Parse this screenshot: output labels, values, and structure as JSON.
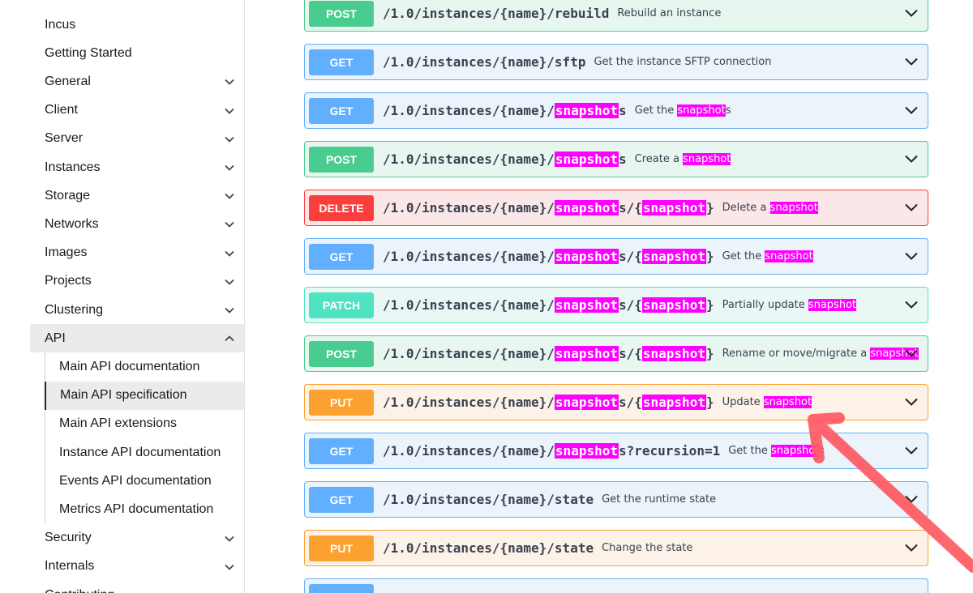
{
  "sidebar": {
    "items": [
      {
        "label": "Incus",
        "chevron": false
      },
      {
        "label": "Getting Started",
        "chevron": false
      },
      {
        "label": "General",
        "chevron": true
      },
      {
        "label": "Client",
        "chevron": true
      },
      {
        "label": "Server",
        "chevron": true
      },
      {
        "label": "Instances",
        "chevron": true
      },
      {
        "label": "Storage",
        "chevron": true
      },
      {
        "label": "Networks",
        "chevron": true
      },
      {
        "label": "Images",
        "chevron": true
      },
      {
        "label": "Projects",
        "chevron": true
      },
      {
        "label": "Clustering",
        "chevron": true
      },
      {
        "label": "API",
        "chevron": true,
        "expanded": true
      }
    ],
    "api_children": [
      "Main API documentation",
      "Main API specification",
      "Main API extensions",
      "Instance API documentation",
      "Events API documentation",
      "Metrics API documentation"
    ],
    "after_items": [
      {
        "label": "Security",
        "chevron": true
      },
      {
        "label": "Internals",
        "chevron": true
      },
      {
        "label": "Contributing",
        "chevron": true
      }
    ]
  },
  "highlight_term": "snapshot",
  "operations": [
    {
      "method": "POST",
      "cls": "post",
      "path": "/1.0/instances/{name}/rebuild",
      "summary": "Rebuild an instance"
    },
    {
      "method": "GET",
      "cls": "get",
      "path": "/1.0/instances/{name}/sftp",
      "summary": "Get the instance SFTP connection"
    },
    {
      "method": "GET",
      "cls": "get",
      "path": "/1.0/instances/{name}/snapshots",
      "summary": "Get the snapshots"
    },
    {
      "method": "POST",
      "cls": "post",
      "path": "/1.0/instances/{name}/snapshots",
      "summary": "Create a snapshot"
    },
    {
      "method": "DELETE",
      "cls": "delete",
      "path": "/1.0/instances/{name}/snapshots/{snapshot}",
      "summary": "Delete a snapshot"
    },
    {
      "method": "GET",
      "cls": "get",
      "path": "/1.0/instances/{name}/snapshots/{snapshot}",
      "summary": "Get the snapshot"
    },
    {
      "method": "PATCH",
      "cls": "patch",
      "path": "/1.0/instances/{name}/snapshots/{snapshot}",
      "summary": "Partially update snapshot"
    },
    {
      "method": "POST",
      "cls": "post",
      "path": "/1.0/instances/{name}/snapshots/{snapshot}",
      "summary": "Rename or move/migrate a snapshot"
    },
    {
      "method": "PUT",
      "cls": "put",
      "path": "/1.0/instances/{name}/snapshots/{snapshot}",
      "summary": "Update snapshot"
    },
    {
      "method": "GET",
      "cls": "get",
      "path": "/1.0/instances/{name}/snapshots?recursion=1",
      "summary": "Get the snapshots"
    },
    {
      "method": "GET",
      "cls": "get",
      "path": "/1.0/instances/{name}/state",
      "summary": "Get the runtime state"
    },
    {
      "method": "PUT",
      "cls": "put",
      "path": "/1.0/instances/{name}/state",
      "summary": "Change the state"
    },
    {
      "method": "",
      "cls": "get",
      "path": "",
      "summary": ""
    }
  ],
  "colors": {
    "get": "#61affe",
    "post": "#49cc90",
    "delete": "#f93e3e",
    "patch": "#50e3c2",
    "put": "#fca130",
    "highlight": "#ff00ff",
    "annotation_arrow": "#ff5a63"
  }
}
